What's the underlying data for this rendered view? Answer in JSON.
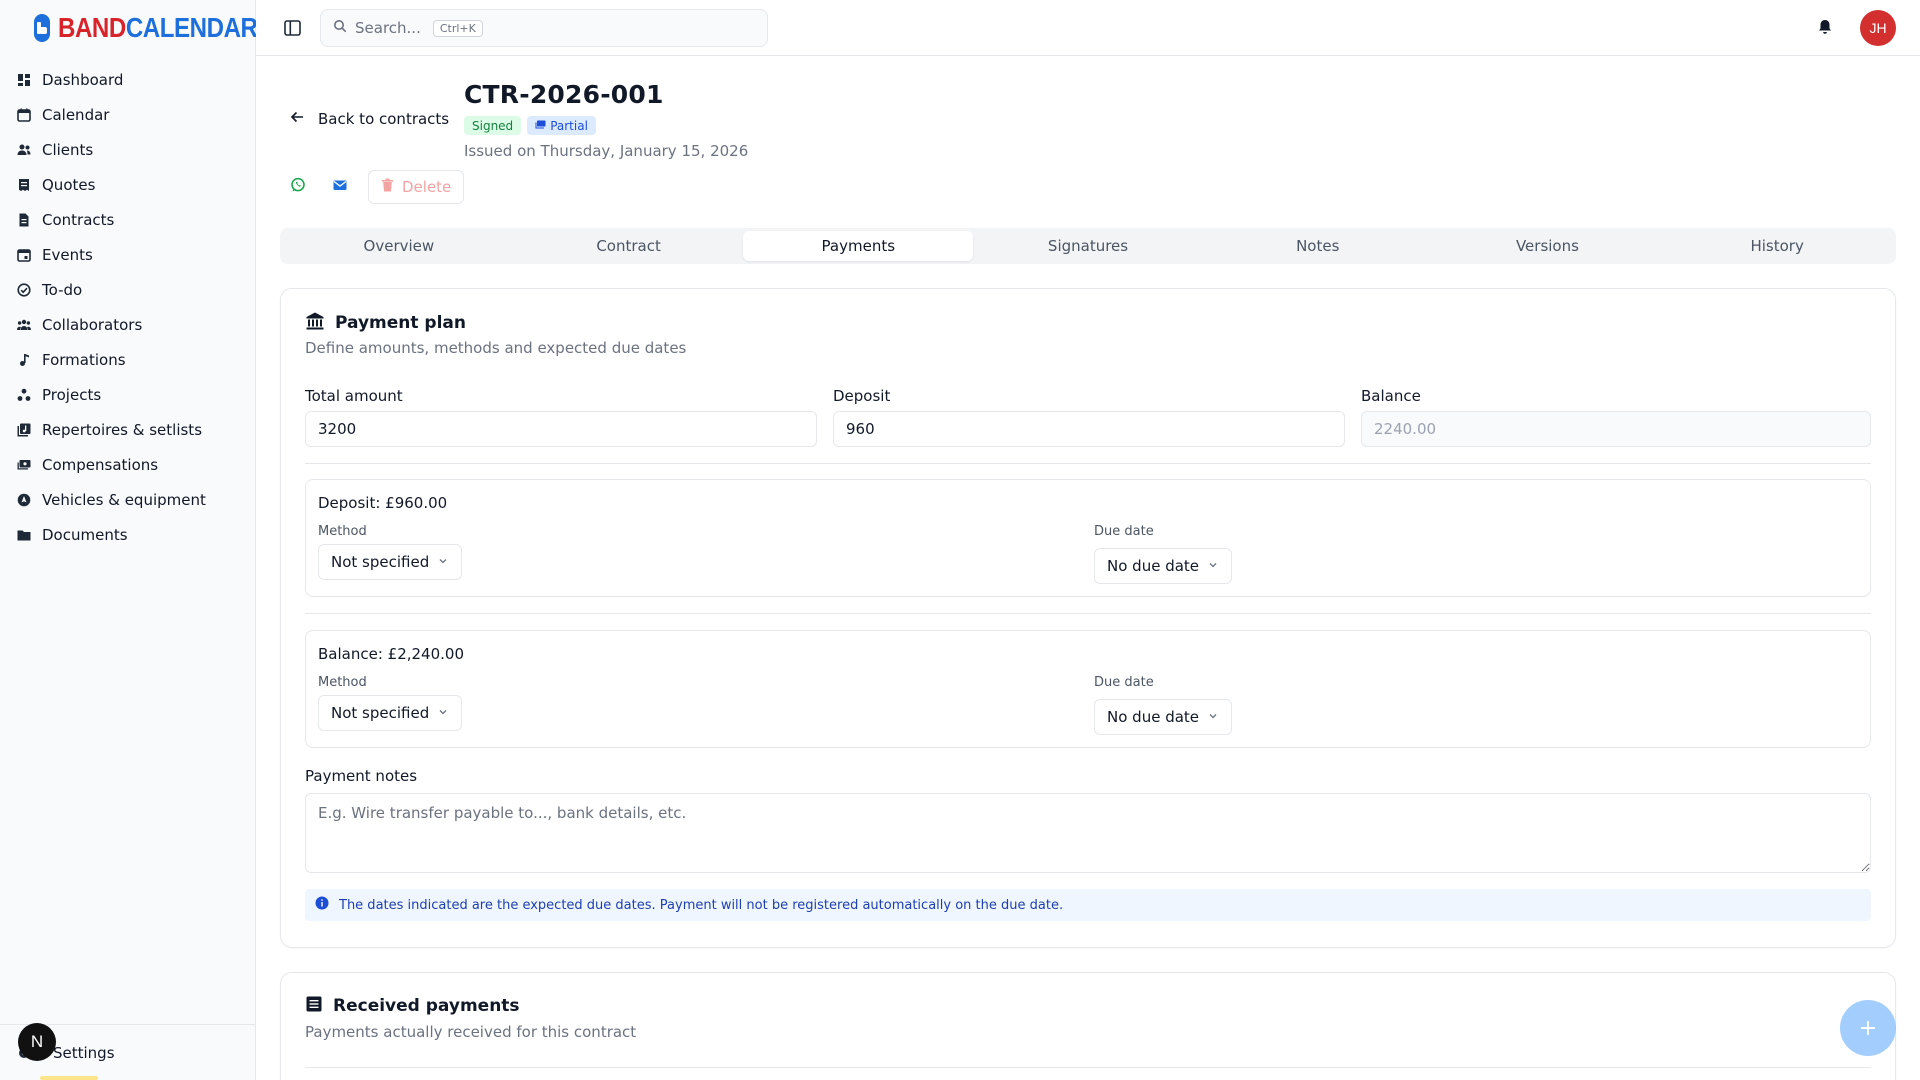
{
  "brand": {
    "part1": "BAND",
    "part2": "CALENDAR"
  },
  "sidebar": {
    "items": [
      {
        "label": "Dashboard",
        "icon": "dashboard-icon"
      },
      {
        "label": "Calendar",
        "icon": "calendar-icon"
      },
      {
        "label": "Clients",
        "icon": "users-icon"
      },
      {
        "label": "Quotes",
        "icon": "receipt-icon"
      },
      {
        "label": "Contracts",
        "icon": "file-icon"
      },
      {
        "label": "Events",
        "icon": "calendar-event-icon"
      },
      {
        "label": "To-do",
        "icon": "check-circle-icon"
      },
      {
        "label": "Collaborators",
        "icon": "group-icon"
      },
      {
        "label": "Formations",
        "icon": "music-note-icon"
      },
      {
        "label": "Projects",
        "icon": "projects-icon"
      },
      {
        "label": "Repertoires & setlists",
        "icon": "repertoire-icon"
      },
      {
        "label": "Compensations",
        "icon": "money-icon"
      },
      {
        "label": "Vehicles & equipment",
        "icon": "vehicle-icon"
      },
      {
        "label": "Documents",
        "icon": "folder-icon"
      }
    ],
    "footer_label": "Settings",
    "n_badge": "N"
  },
  "topbar": {
    "search_placeholder": "Search...",
    "search_shortcut": "Ctrl+K",
    "avatar_initials": "JH"
  },
  "contract": {
    "back_label": "Back to contracts",
    "title": "CTR-2026-001",
    "badge_signed": "Signed",
    "badge_partial": "Partial",
    "issued": "Issued on Thursday, January 15, 2026",
    "delete_label": "Delete"
  },
  "tabs": [
    "Overview",
    "Contract",
    "Payments",
    "Signatures",
    "Notes",
    "Versions",
    "History"
  ],
  "active_tab": "Payments",
  "payment_plan": {
    "title": "Payment plan",
    "subtitle": "Define amounts, methods and expected due dates",
    "total_label": "Total amount",
    "total_value": "3200",
    "deposit_label": "Deposit",
    "deposit_value": "960",
    "balance_label": "Balance",
    "balance_value": "2240.00",
    "deposit_block": {
      "title": "Deposit: £960.00",
      "method_label": "Method",
      "method_value": "Not specified",
      "due_label": "Due date",
      "due_value": "No due date"
    },
    "balance_block": {
      "title": "Balance: £2,240.00",
      "method_label": "Method",
      "method_value": "Not specified",
      "due_label": "Due date",
      "due_value": "No due date"
    },
    "notes_label": "Payment notes",
    "notes_placeholder": "E.g. Wire transfer payable to..., bank details, etc.",
    "info_text": "The dates indicated are the expected due dates. Payment will not be registered automatically on the due date."
  },
  "received": {
    "title": "Received payments",
    "subtitle": "Payments actually received for this contract",
    "fab_label": "+"
  },
  "colors": {
    "brand_red": "#d8232a",
    "brand_blue": "#1d6fdc",
    "avatar": "#d32f2f",
    "signed": "#15803d",
    "partial": "#1d4ed8"
  }
}
